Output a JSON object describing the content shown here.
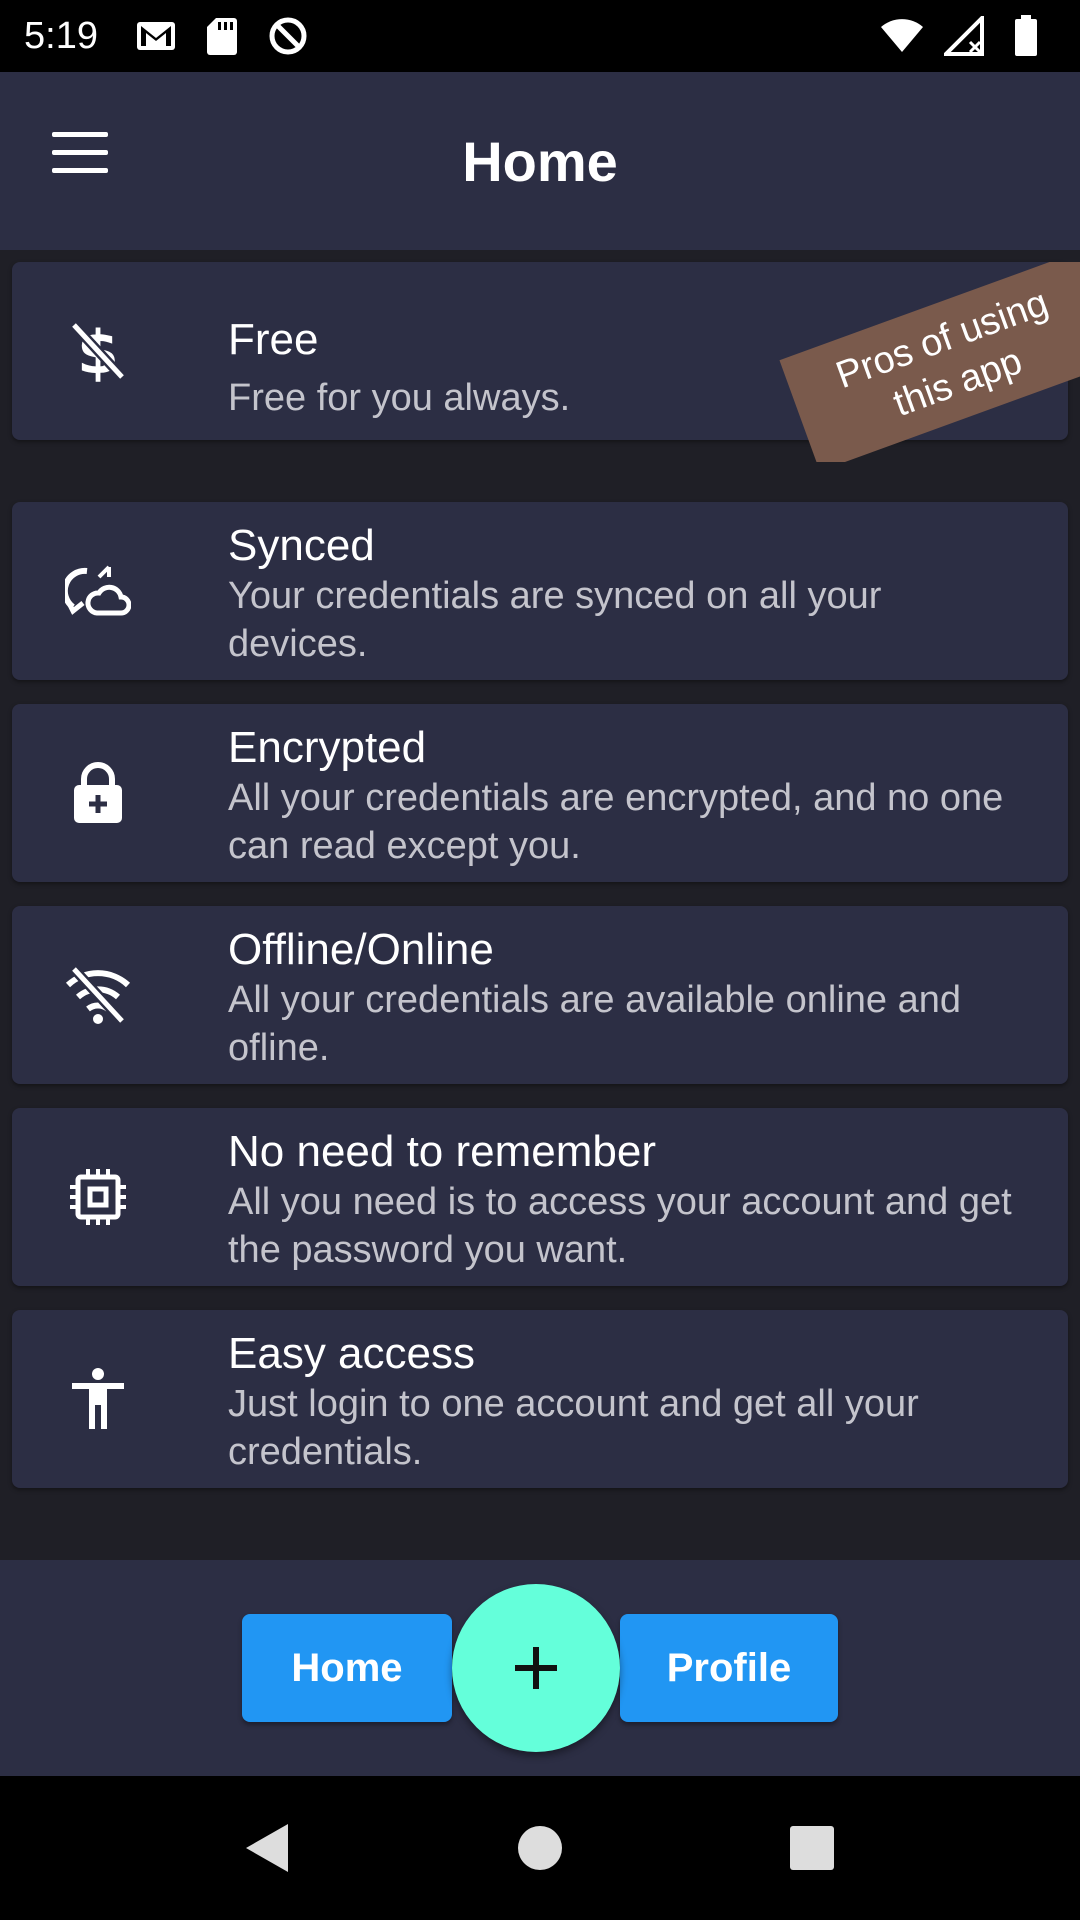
{
  "status_bar": {
    "time": "5:19",
    "left_icons": [
      "gmail-icon",
      "sd-card-icon",
      "data-saver-icon"
    ],
    "right_icons": [
      "wifi-icon",
      "cell-signal-icon",
      "battery-icon"
    ]
  },
  "app_bar": {
    "title": "Home",
    "menu_icon": "hamburger-menu-icon"
  },
  "ribbon": {
    "text": "Pros of using this app",
    "color": "#7a5a4c"
  },
  "features": [
    {
      "title": "Free",
      "description": "Free for you always.",
      "icon": "money-off-icon"
    },
    {
      "title": "Synced",
      "description": "Your credentials are synced on all your devices.",
      "icon": "cloud-sync-icon"
    },
    {
      "title": "Encrypted",
      "description": "All your credentials are encrypted, and no one can read except you.",
      "icon": "lock-add-icon"
    },
    {
      "title": "Offline/Online",
      "description": "All your credentials are available online and ofline.",
      "icon": "wifi-off-icon"
    },
    {
      "title": "No need to remember",
      "description": "All you need is to access your account and get the password you want.",
      "icon": "memory-chip-icon"
    },
    {
      "title": "Easy access",
      "description": "Just login to one account and get all your credentials.",
      "icon": "accessibility-icon"
    }
  ],
  "bottom_nav": {
    "home_label": "Home",
    "profile_label": "Profile",
    "fab_icon": "plus-icon",
    "button_color": "#2196f3",
    "fab_color": "#64ffda"
  },
  "system_nav": [
    "back-icon",
    "home-circle-icon",
    "recents-icon"
  ],
  "colors": {
    "background": "#1f1f26",
    "surface": "#2c2e44"
  }
}
